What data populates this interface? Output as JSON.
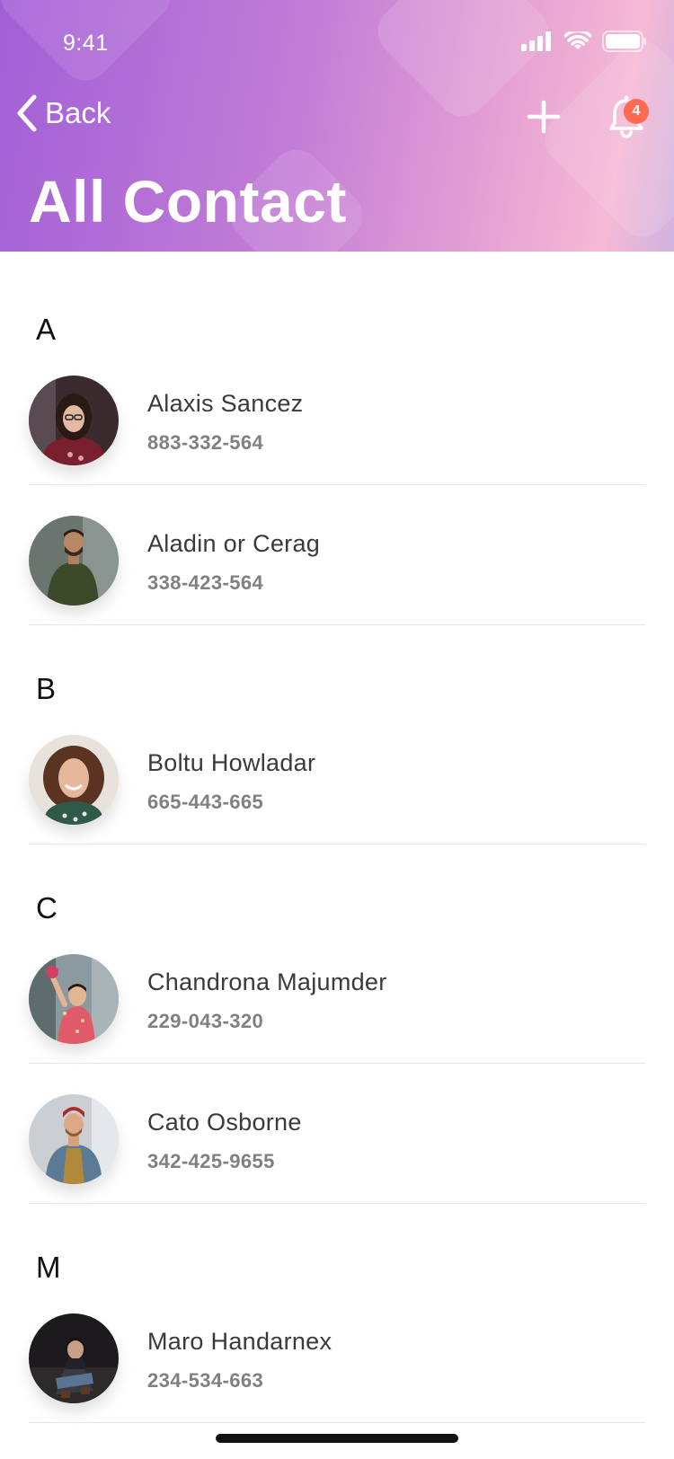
{
  "status_bar": {
    "time": "9:41"
  },
  "header": {
    "back_label": "Back",
    "title": "All Contact",
    "notification_count": "4",
    "add_icon": "plus-icon",
    "bell_icon": "bell-icon"
  },
  "sections": [
    {
      "letter": "A",
      "contacts": [
        {
          "name": "Alaxis Sancez",
          "phone": "883-332-564"
        },
        {
          "name": "Aladin or Cerag",
          "phone": "338-423-564"
        }
      ]
    },
    {
      "letter": "B",
      "contacts": [
        {
          "name": "Boltu Howladar",
          "phone": "665-443-665"
        }
      ]
    },
    {
      "letter": "C",
      "contacts": [
        {
          "name": "Chandrona Majumder",
          "phone": "229-043-320"
        },
        {
          "name": "Cato Osborne",
          "phone": "342-425-9655"
        }
      ]
    },
    {
      "letter": "M",
      "contacts": [
        {
          "name": "Maro Handarnex",
          "phone": "234-534-663"
        }
      ]
    }
  ],
  "colors": {
    "header_gradient_start": "#a25fd6",
    "header_gradient_end": "#f5b9d4",
    "badge": "#ff6b50",
    "name_text": "#3a3a3a",
    "phone_text": "#808080"
  }
}
